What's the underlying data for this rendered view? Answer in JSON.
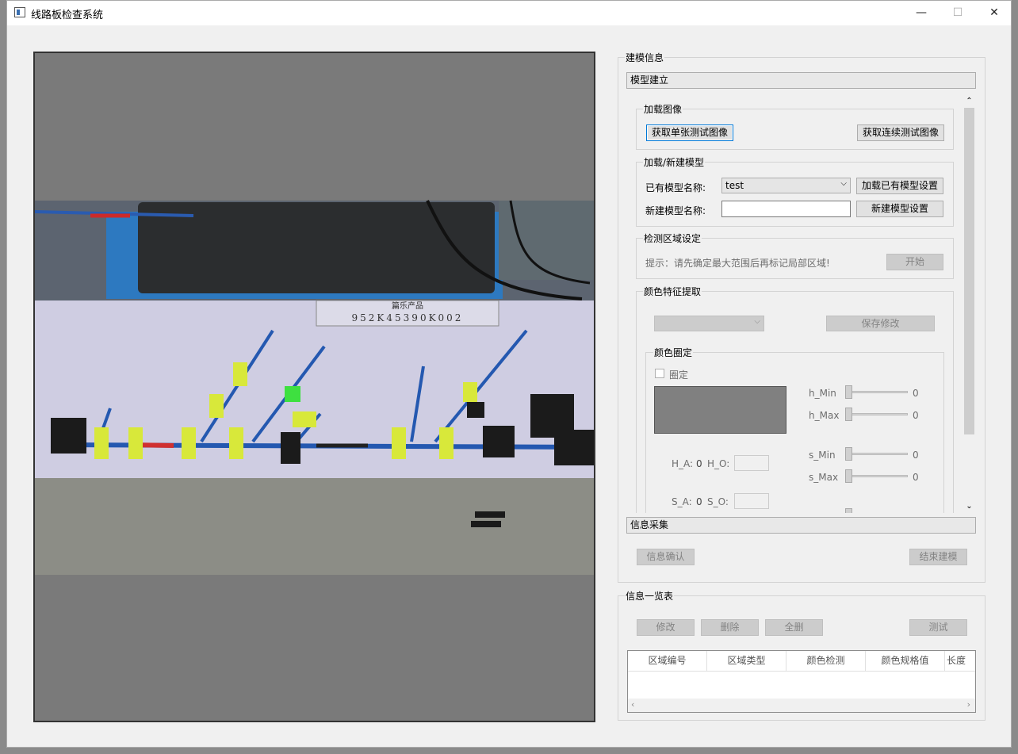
{
  "window": {
    "title": "线路板检查系统",
    "minimize": "—",
    "maximize": "☐",
    "close": "✕"
  },
  "image_view": {
    "board_label": "篇乐产品",
    "board_code": "952K45390K002"
  },
  "modeling": {
    "title": "建模信息",
    "section_model_build": "模型建立",
    "load_image": {
      "title": "加载图像",
      "single_button": "获取单张测试图像",
      "continuous_button": "获取连续测试图像"
    },
    "load_model": {
      "title": "加载/新建模型",
      "existing_label": "已有模型名称:",
      "existing_value": "test",
      "load_button": "加载已有模型设置",
      "new_label": "新建模型名称:",
      "new_value": "",
      "new_button": "新建模型设置"
    },
    "detect_region": {
      "title": "检测区域设定",
      "hint": "提示：请先确定最大范围后再标记局部区域!",
      "start_button": "开始"
    },
    "color_feature": {
      "title": "颜色特征提取",
      "select_value": "",
      "save_button": "保存修改",
      "fixed_group_title": "颜色圈定",
      "fixed_checkbox": "圈定",
      "h_min_label": "h_Min",
      "h_min_value": "0",
      "h_max_label": "h_Max",
      "h_max_value": "0",
      "s_min_label": "s_Min",
      "s_min_value": "0",
      "s_max_label": "s_Max",
      "s_max_value": "0",
      "ha_label": "H_A:",
      "ha_value": "0",
      "ho_label": "H_O:",
      "sa_label": "S_A:",
      "sa_value": "0",
      "so_label": "S_O:"
    },
    "section_info_collect": "信息采集",
    "confirm_button": "信息确认",
    "finish_button": "结束建模"
  },
  "info_list": {
    "title": "信息一览表",
    "modify_button": "修改",
    "delete_button": "删除",
    "delete_all_button": "全删",
    "test_button": "测试",
    "columns": [
      "区域编号",
      "区域类型",
      "颜色检测",
      "颜色规格值",
      "长度"
    ]
  },
  "colors": {
    "focus_blue": "#0078d7",
    "window_bg": "#f0f0f0",
    "image_bg": "#7a7a7a"
  }
}
